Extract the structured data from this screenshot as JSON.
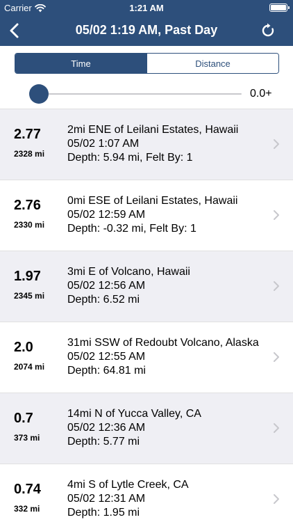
{
  "status": {
    "carrier": "Carrier",
    "time": "1:21 AM"
  },
  "nav": {
    "title": "05/02 1:19 AM, Past Day",
    "back_icon": "chevron-left-icon",
    "refresh_icon": "refresh-icon"
  },
  "segments": [
    {
      "label": "Time",
      "active": true
    },
    {
      "label": "Distance",
      "active": false
    }
  ],
  "slider": {
    "value_label": "0.0+",
    "level": 0
  },
  "colors": {
    "primary": "#2d4f7b",
    "row_alt": "#efeff4",
    "chevron": "#c7c7cc"
  },
  "quakes": [
    {
      "magnitude": "2.77",
      "distance": "2328 mi",
      "place": "2mi ENE of Leilani Estates, Hawaii",
      "time": "05/02 1:07 AM",
      "detail": "Depth: 5.94 mi, Felt By: 1"
    },
    {
      "magnitude": "2.76",
      "distance": "2330 mi",
      "place": "0mi ESE of Leilani Estates, Hawaii",
      "time": "05/02 12:59 AM",
      "detail": "Depth: -0.32 mi, Felt By: 1"
    },
    {
      "magnitude": "1.97",
      "distance": "2345 mi",
      "place": "3mi E of Volcano, Hawaii",
      "time": "05/02 12:56 AM",
      "detail": "Depth: 6.52 mi"
    },
    {
      "magnitude": "2.0",
      "distance": "2074 mi",
      "place": "31mi SSW of Redoubt Volcano, Alaska",
      "time": "05/02 12:55 AM",
      "detail": "Depth: 64.81 mi"
    },
    {
      "magnitude": "0.7",
      "distance": "373 mi",
      "place": "14mi N of Yucca Valley, CA",
      "time": "05/02 12:36 AM",
      "detail": "Depth: 5.77 mi"
    },
    {
      "magnitude": "0.74",
      "distance": "332 mi",
      "place": "4mi S of Lytle Creek, CA",
      "time": "05/02 12:31 AM",
      "detail": "Depth: 1.95 mi"
    }
  ]
}
